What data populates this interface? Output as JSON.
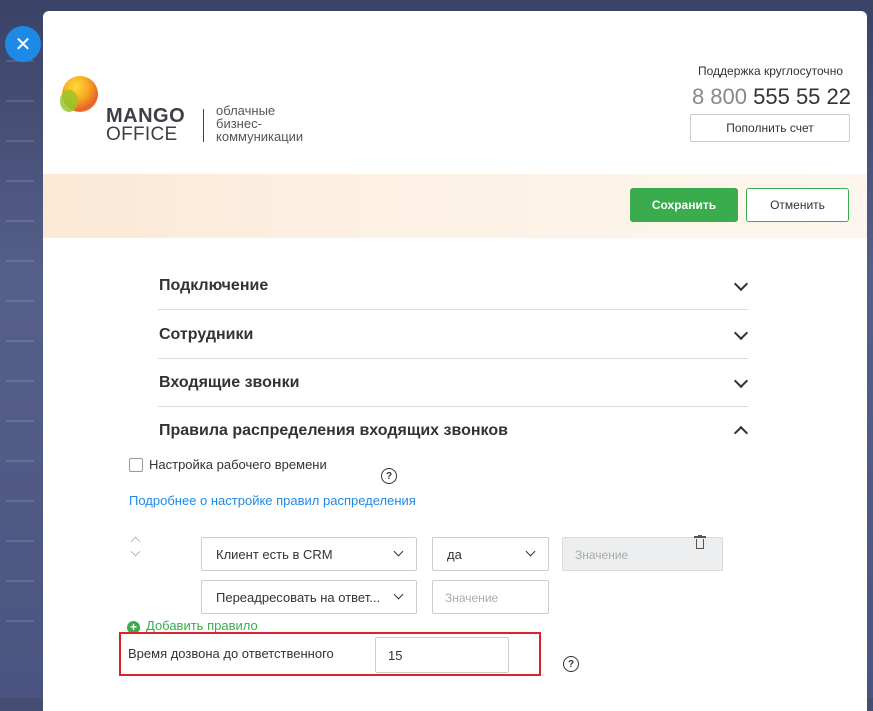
{
  "close": {
    "icon": "close-icon",
    "glyph": "✕"
  },
  "header": {
    "logo": {
      "mango": "MANGO",
      "office": "OFFICE",
      "tagline": [
        "облачные",
        "бизнес-",
        "коммуникации"
      ]
    },
    "support": {
      "label": "Поддержка круглосуточно",
      "phone_prefix": "8 800",
      "phone_number": "555 55 22",
      "topup_label": "Пополнить счет"
    }
  },
  "toolbar": {
    "save_label": "Сохранить",
    "cancel_label": "Отменить"
  },
  "sections": [
    {
      "title": "Подключение",
      "expanded": false
    },
    {
      "title": "Сотрудники",
      "expanded": false
    },
    {
      "title": "Входящие звонки",
      "expanded": false
    },
    {
      "title": "Правила распределения входящих звонков",
      "expanded": true
    }
  ],
  "rules": {
    "work_time_label": "Настройка рабочего времени",
    "work_time_checked": false,
    "help_glyph": "?",
    "more_link": "Подробнее о настройке правил распределения",
    "rule1": {
      "condition": "Клиент есть в CRM",
      "operator": "да",
      "value_placeholder": "Значение",
      "action": "Переадресовать на ответ...",
      "action_value_placeholder": "Значение"
    },
    "add_rule_label": "Добавить правило",
    "ring_time_label": "Время дозвона до ответственного",
    "ring_time_value": "15"
  },
  "colors": {
    "accent_green": "#3aac4e",
    "link_blue": "#1e8ae6",
    "highlight_red": "#d9232d"
  }
}
